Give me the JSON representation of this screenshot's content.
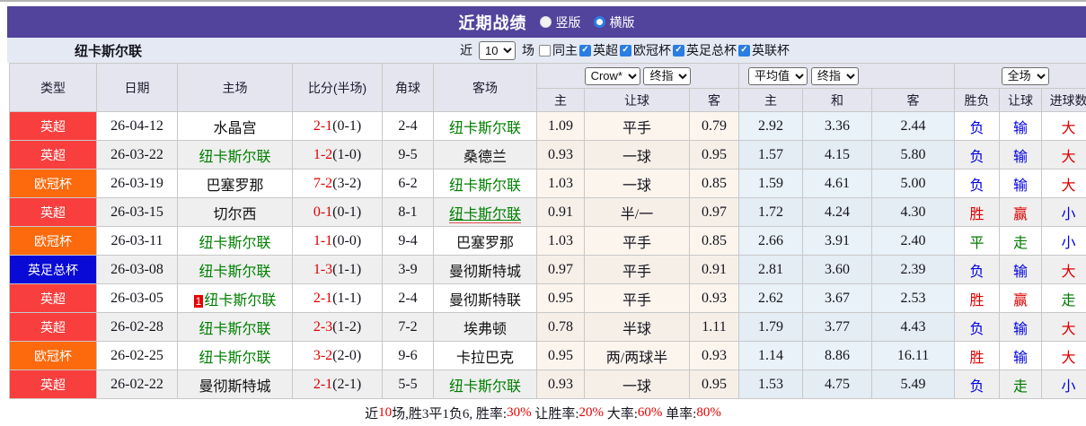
{
  "page": {
    "title": "近期战绩",
    "layout_options": [
      {
        "label": "竖版",
        "checked": false
      },
      {
        "label": "横版",
        "checked": true
      }
    ]
  },
  "toolbar": {
    "team": "纽卡斯尔联",
    "recent_prefix": "近",
    "recent_value": "10",
    "recent_suffix": "场",
    "filters": [
      {
        "label": "同主",
        "checked": false
      },
      {
        "label": "英超",
        "checked": true
      },
      {
        "label": "欧冠杯",
        "checked": true
      },
      {
        "label": "英足总杯",
        "checked": true
      },
      {
        "label": "英联杯",
        "checked": true
      }
    ]
  },
  "table": {
    "columns": [
      "类型",
      "日期",
      "主场",
      "比分(半场)",
      "角球",
      "客场"
    ],
    "odds_selects": [
      "Crow*",
      "终指"
    ],
    "avg_selects": [
      "平均值",
      "终指"
    ],
    "scope_select": "全场",
    "sub_columns": [
      "主",
      "让球",
      "客",
      "主",
      "和",
      "客",
      "胜负",
      "让球",
      "进球数"
    ],
    "rows": [
      {
        "league": "英超",
        "date": "26-04-12",
        "home": "水晶宫",
        "home_self": false,
        "home_card": "",
        "score": "2-1",
        "half": "(0-1)",
        "corners": "2-4",
        "away": "纽卡斯尔联",
        "away_self": true,
        "away_underline": false,
        "odds": [
          "1.09",
          "平手",
          "0.79"
        ],
        "avg": [
          "2.92",
          "3.36",
          "2.44"
        ],
        "results": [
          [
            "负",
            "blue"
          ],
          [
            "输",
            "blue"
          ],
          [
            "大",
            "red"
          ]
        ]
      },
      {
        "league": "英超",
        "date": "26-03-22",
        "home": "纽卡斯尔联",
        "home_self": true,
        "home_card": "",
        "score": "1-2",
        "half": "(1-0)",
        "corners": "9-5",
        "away": "桑德兰",
        "away_self": false,
        "away_underline": false,
        "odds": [
          "0.93",
          "一球",
          "0.95"
        ],
        "avg": [
          "1.57",
          "4.15",
          "5.80"
        ],
        "results": [
          [
            "负",
            "blue"
          ],
          [
            "输",
            "blue"
          ],
          [
            "大",
            "red"
          ]
        ]
      },
      {
        "league": "欧冠杯",
        "date": "26-03-19",
        "home": "巴塞罗那",
        "home_self": false,
        "home_card": "",
        "score": "7-2",
        "half": "(3-2)",
        "corners": "6-2",
        "away": "纽卡斯尔联",
        "away_self": true,
        "away_underline": false,
        "odds": [
          "1.03",
          "一球",
          "0.85"
        ],
        "avg": [
          "1.59",
          "4.61",
          "5.00"
        ],
        "results": [
          [
            "负",
            "blue"
          ],
          [
            "输",
            "blue"
          ],
          [
            "大",
            "red"
          ]
        ]
      },
      {
        "league": "英超",
        "date": "26-03-15",
        "home": "切尔西",
        "home_self": false,
        "home_card": "",
        "score": "0-1",
        "half": "(0-1)",
        "corners": "8-1",
        "away": "纽卡斯尔联",
        "away_self": true,
        "away_underline": true,
        "odds": [
          "0.91",
          "半/一",
          "0.97"
        ],
        "avg": [
          "1.72",
          "4.24",
          "4.30"
        ],
        "results": [
          [
            "胜",
            "red"
          ],
          [
            "赢",
            "red"
          ],
          [
            "小",
            "blue"
          ]
        ]
      },
      {
        "league": "欧冠杯",
        "date": "26-03-11",
        "home": "纽卡斯尔联",
        "home_self": true,
        "home_card": "",
        "score": "1-1",
        "half": "(0-0)",
        "corners": "9-4",
        "away": "巴塞罗那",
        "away_self": false,
        "away_underline": false,
        "odds": [
          "1.03",
          "平手",
          "0.85"
        ],
        "avg": [
          "2.66",
          "3.91",
          "2.40"
        ],
        "results": [
          [
            "平",
            "green"
          ],
          [
            "走",
            "green"
          ],
          [
            "小",
            "blue"
          ]
        ]
      },
      {
        "league": "英足总杯",
        "date": "26-03-08",
        "home": "纽卡斯尔联",
        "home_self": true,
        "home_card": "",
        "score": "1-3",
        "half": "(1-1)",
        "corners": "3-9",
        "away": "曼彻斯特城",
        "away_self": false,
        "away_underline": false,
        "odds": [
          "0.97",
          "平手",
          "0.91"
        ],
        "avg": [
          "2.81",
          "3.60",
          "2.39"
        ],
        "results": [
          [
            "负",
            "blue"
          ],
          [
            "输",
            "blue"
          ],
          [
            "大",
            "red"
          ]
        ]
      },
      {
        "league": "英超",
        "date": "26-03-05",
        "home": "纽卡斯尔联",
        "home_self": true,
        "home_card": "1",
        "score": "2-1",
        "half": "(1-1)",
        "corners": "2-4",
        "away": "曼彻斯特联",
        "away_self": false,
        "away_underline": false,
        "odds": [
          "0.95",
          "平手",
          "0.93"
        ],
        "avg": [
          "2.62",
          "3.67",
          "2.53"
        ],
        "results": [
          [
            "胜",
            "red"
          ],
          [
            "赢",
            "red"
          ],
          [
            "走",
            "green"
          ]
        ]
      },
      {
        "league": "英超",
        "date": "26-02-28",
        "home": "纽卡斯尔联",
        "home_self": true,
        "home_card": "",
        "score": "2-3",
        "half": "(1-2)",
        "corners": "7-2",
        "away": "埃弗顿",
        "away_self": false,
        "away_underline": false,
        "odds": [
          "0.78",
          "半球",
          "1.11"
        ],
        "avg": [
          "1.79",
          "3.77",
          "4.43"
        ],
        "results": [
          [
            "负",
            "blue"
          ],
          [
            "输",
            "blue"
          ],
          [
            "大",
            "red"
          ]
        ]
      },
      {
        "league": "欧冠杯",
        "date": "26-02-25",
        "home": "纽卡斯尔联",
        "home_self": true,
        "home_card": "",
        "score": "3-2",
        "half": "(2-0)",
        "corners": "9-6",
        "away": "卡拉巴克",
        "away_self": false,
        "away_underline": false,
        "odds": [
          "0.95",
          "两/两球半",
          "0.93"
        ],
        "avg": [
          "1.14",
          "8.86",
          "16.11"
        ],
        "results": [
          [
            "胜",
            "red"
          ],
          [
            "输",
            "blue"
          ],
          [
            "大",
            "red"
          ]
        ]
      },
      {
        "league": "英超",
        "date": "26-02-22",
        "home": "曼彻斯特城",
        "home_self": false,
        "home_card": "",
        "score": "2-1",
        "half": "(2-1)",
        "corners": "5-5",
        "away": "纽卡斯尔联",
        "away_self": true,
        "away_underline": false,
        "odds": [
          "0.93",
          "一球",
          "0.95"
        ],
        "avg": [
          "1.53",
          "4.75",
          "5.49"
        ],
        "results": [
          [
            "负",
            "blue"
          ],
          [
            "走",
            "green"
          ],
          [
            "小",
            "blue"
          ]
        ]
      }
    ]
  },
  "summary": {
    "parts": [
      "近",
      "10",
      "场,胜3平1负6, 胜率:",
      "30%",
      " 让胜率:",
      "20%",
      " 大率:",
      "60%",
      " 单率:",
      "80%"
    ]
  },
  "colors": {
    "red": "#e00000",
    "blue": "#0000e0",
    "green": "#007a00",
    "team_self": "#008000",
    "team_other": "#111111",
    "league": {
      "英超": "#f93e3e",
      "欧冠杯": "#fd6a0d",
      "英足总杯": "#0a0ad6"
    }
  }
}
